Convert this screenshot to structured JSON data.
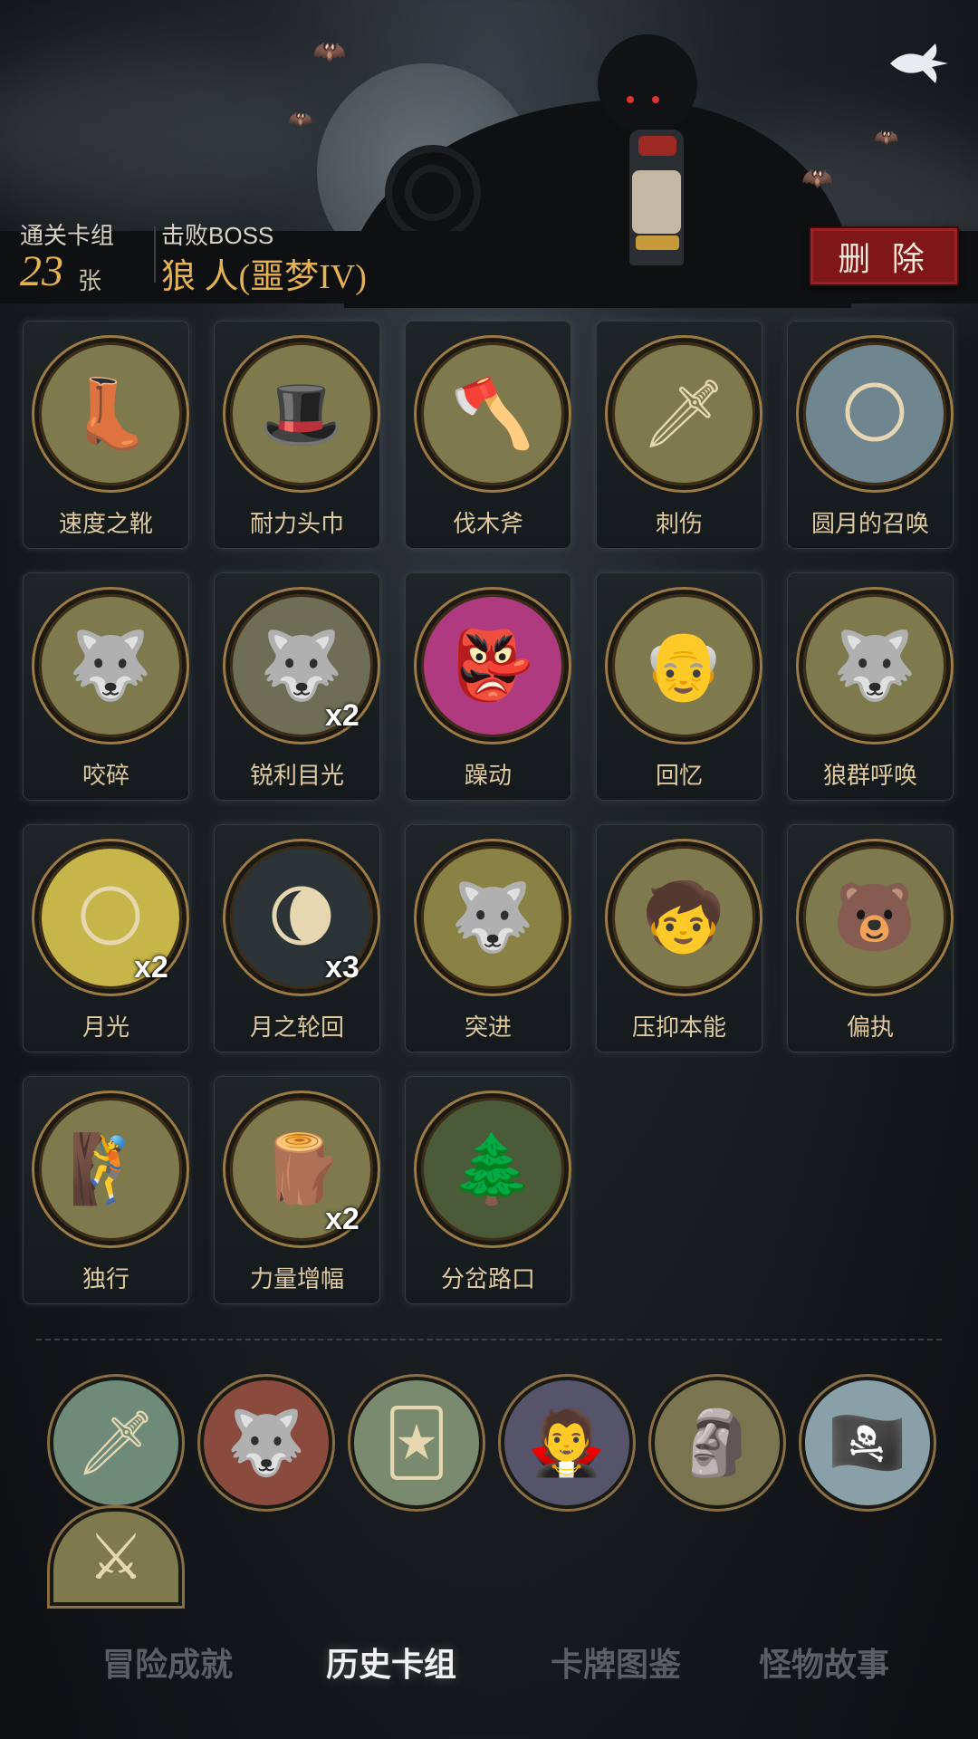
{
  "header": {
    "deck_label": "通关卡组",
    "deck_count": "23",
    "deck_unit": "张",
    "boss_label": "击败BOSS",
    "boss_name": "狼 人(噩梦IV)",
    "delete_label": "删 除"
  },
  "cards": [
    {
      "name": "速度之靴",
      "icon": "boot-icon",
      "glyph": "👢",
      "bg": "#7e7a4e",
      "multiplier": ""
    },
    {
      "name": "耐力头巾",
      "icon": "bandana-icon",
      "glyph": "🎩",
      "bg": "#7e7a4e",
      "multiplier": ""
    },
    {
      "name": "伐木斧",
      "icon": "axe-icon",
      "glyph": "🪓",
      "bg": "#7e7a4e",
      "multiplier": ""
    },
    {
      "name": "刺伤",
      "icon": "dagger-icon",
      "glyph": "🗡",
      "bg": "#7e7a4e",
      "multiplier": ""
    },
    {
      "name": "圆月的召唤",
      "icon": "full-moon-forest-icon",
      "glyph": "🌕",
      "bg": "#6f8590",
      "multiplier": ""
    },
    {
      "name": "咬碎",
      "icon": "werewolf-bite-icon",
      "glyph": "🐺",
      "bg": "#7e7a4e",
      "multiplier": ""
    },
    {
      "name": "锐利目光",
      "icon": "werewolf-glare-icon",
      "glyph": "🐺",
      "bg": "#6e6e56",
      "multiplier": "x2"
    },
    {
      "name": "躁动",
      "icon": "rage-mask-icon",
      "glyph": "👺",
      "bg": "#b03a80",
      "multiplier": ""
    },
    {
      "name": "回忆",
      "icon": "old-man-icon",
      "glyph": "👴",
      "bg": "#7e7a4e",
      "multiplier": ""
    },
    {
      "name": "狼群呼唤",
      "icon": "wolf-pack-icon",
      "glyph": "🐺",
      "bg": "#7e7a4e",
      "multiplier": ""
    },
    {
      "name": "月光",
      "icon": "moonlight-icon",
      "glyph": "🌕",
      "bg": "#c6b548",
      "multiplier": "x2"
    },
    {
      "name": "月之轮回",
      "icon": "moon-phases-icon",
      "glyph": "🌘",
      "bg": "#2c3438",
      "multiplier": "x3"
    },
    {
      "name": "突进",
      "icon": "werewolf-charge-icon",
      "glyph": "🐺",
      "bg": "#8a8244",
      "multiplier": ""
    },
    {
      "name": "压抑本能",
      "icon": "restrain-instinct-icon",
      "glyph": "🧒",
      "bg": "#7e7a4e",
      "multiplier": ""
    },
    {
      "name": "偏执",
      "icon": "wolf-bear-icon",
      "glyph": "🐻",
      "bg": "#7e7a4e",
      "multiplier": ""
    },
    {
      "name": "独行",
      "icon": "lone-hiker-icon",
      "glyph": "🧗",
      "bg": "#7e7a4e",
      "multiplier": ""
    },
    {
      "name": "力量增幅",
      "icon": "log-lift-icon",
      "glyph": "🪵",
      "bg": "#7e7a4e",
      "multiplier": "x2"
    },
    {
      "name": "分岔路口",
      "icon": "forest-crossroad-icon",
      "glyph": "🌲",
      "bg": "#4b5a38",
      "multiplier": ""
    }
  ],
  "bosses": [
    {
      "icon": "knife-card-icon",
      "glyph": "🗡",
      "bg": "#6e8a78"
    },
    {
      "icon": "werewolf-icon",
      "glyph": "🐺",
      "bg": "#8a4a3e"
    },
    {
      "icon": "hand-cards-icon",
      "glyph": "🃏",
      "bg": "#7a8a6e"
    },
    {
      "icon": "vampire-icon",
      "glyph": "🧛",
      "bg": "#55546a"
    },
    {
      "icon": "gargoyle-statue-icon",
      "glyph": "🗿",
      "bg": "#7a7450"
    },
    {
      "icon": "pirate-icon",
      "glyph": "🏴‍☠️",
      "bg": "#8aa0a8"
    },
    {
      "icon": "crossed-blades-icon",
      "glyph": "⚔",
      "bg": "#7e7a4e"
    }
  ],
  "tabs": [
    {
      "label": "冒险成就",
      "active": false
    },
    {
      "label": "历史卡组",
      "active": true
    },
    {
      "label": "卡牌图鉴",
      "active": false
    },
    {
      "label": "怪物故事",
      "active": false
    }
  ]
}
